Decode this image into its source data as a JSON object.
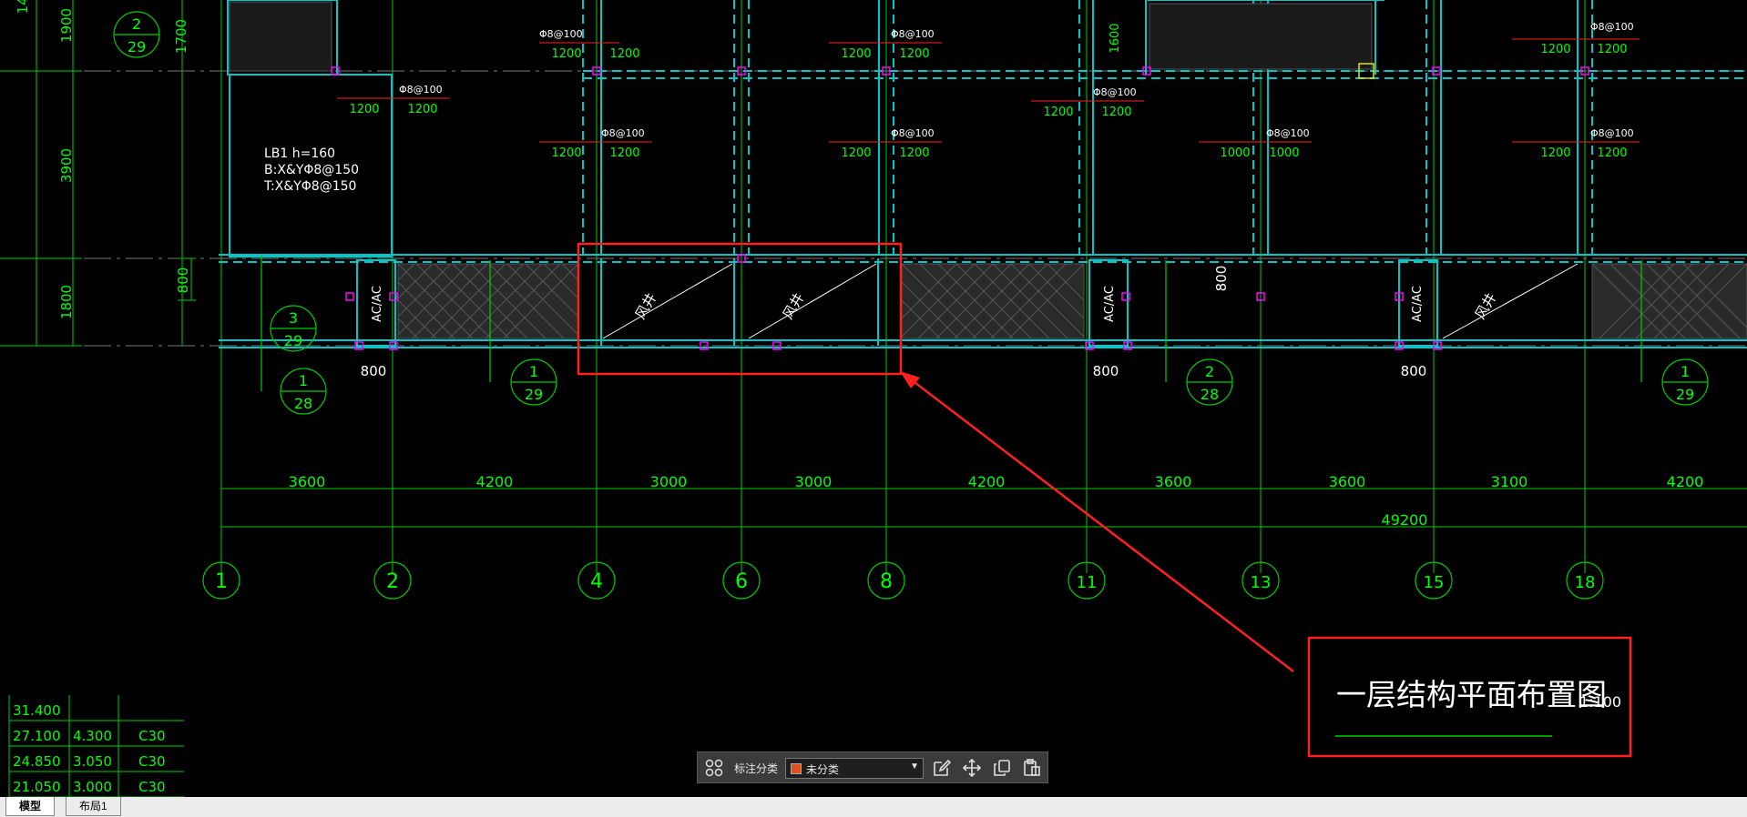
{
  "colors": {
    "background": "#000000",
    "dimension_green": "#00ff00",
    "wall_cyan": "#00c8c8",
    "column_magenta": "#ff00ff",
    "highlight_red": "#ff2020",
    "label_white": "#ffffff"
  },
  "drawing": {
    "title": "一层结构平面布置图",
    "scale": "1:100",
    "overall_dimension": "49200",
    "spans": [
      "3600",
      "4200",
      "3000",
      "3000",
      "4200",
      "3600",
      "3600",
      "3100",
      "4200"
    ],
    "axes": [
      "1",
      "2",
      "4",
      "6",
      "8",
      "11",
      "13",
      "15",
      "18"
    ],
    "left_dimensions": [
      "1900",
      "1700",
      "3900",
      "800",
      "1800"
    ],
    "top_left_partial": "14",
    "slab_note": [
      "LB1   h=160",
      "B:X&YΦ8@150",
      "T:X&YΦ8@150"
    ],
    "section_marks": [
      {
        "num": "2",
        "sheet": "29"
      },
      {
        "num": "3",
        "sheet": "29"
      },
      {
        "num": "1",
        "sheet": "28"
      },
      {
        "num": "1",
        "sheet": "29"
      },
      {
        "num": "2",
        "sheet": "28"
      },
      {
        "num": "1",
        "sheet": "29"
      }
    ],
    "rebar_label": "Φ8@100",
    "rebar_lengths": [
      "1200",
      "1000",
      "1600"
    ],
    "opening_label": "风井",
    "ac_label": "AC/AC",
    "small_dims": [
      "800",
      "800",
      "800",
      "800"
    ]
  },
  "table": {
    "rows": [
      [
        "31.400",
        "",
        ""
      ],
      [
        "27.100",
        "4.300",
        "C30"
      ],
      [
        "24.850",
        "3.050",
        "C30"
      ],
      [
        "21.050",
        "3.000",
        "C30"
      ]
    ]
  },
  "toolbar": {
    "label": "标注分类",
    "selected": "未分类",
    "swatch_color": "#e0501a",
    "icons": [
      "grid-icon",
      "edit-icon",
      "move-icon",
      "copy-icon",
      "paste-icon"
    ]
  },
  "tabs": {
    "model": "模型",
    "layout1": "布局1"
  }
}
